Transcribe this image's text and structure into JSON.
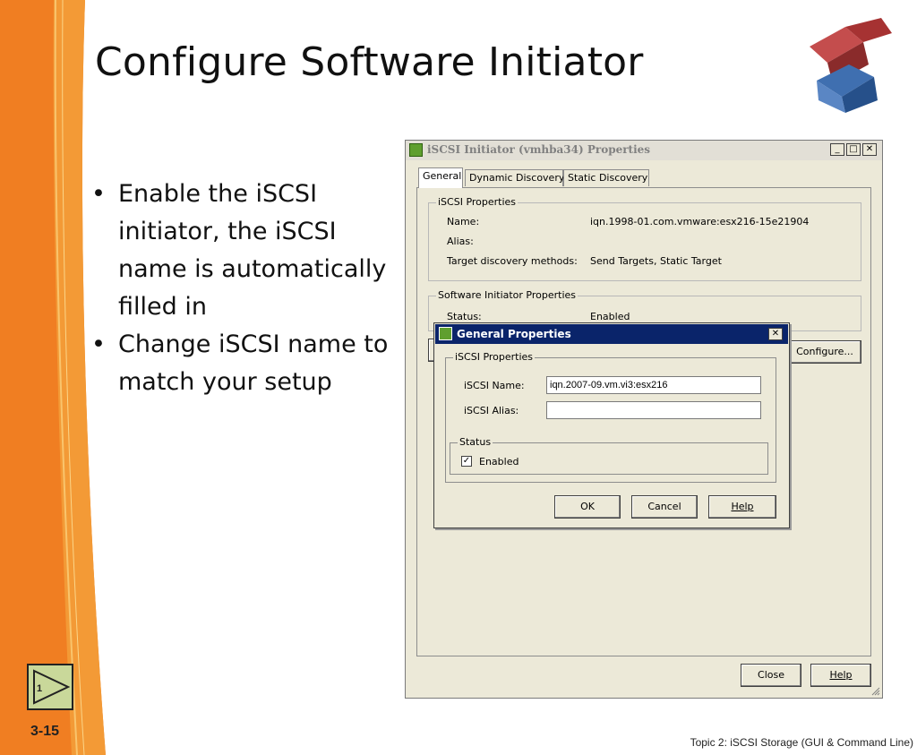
{
  "slide": {
    "title": "Configure Software Initiator",
    "bullets": [
      "Enable the iSCSI initiator, the iSCSI name is automatically filled in",
      "Change iSCSI name to match your setup"
    ],
    "nav_button_label": "1",
    "slide_number": "3-15",
    "footer": "Topic 2:  iSCSI Storage (GUI & Command Line)",
    "colors": {
      "band": "#f07e22",
      "band_light": "#f7b64a",
      "logo_red": "#b33a3a",
      "logo_blue": "#2f5f9f"
    }
  },
  "main_dialog": {
    "title": "iSCSI Initiator (vmhba34) Properties",
    "window_buttons": {
      "minimize": "_",
      "maximize": "□",
      "close": "✕"
    },
    "tabs": [
      "General",
      "Dynamic Discovery",
      "Static Discovery"
    ],
    "iscsi_props": {
      "legend": "iSCSI Properties",
      "name_label": "Name:",
      "name_value": "iqn.1998-01.com.vmware:esx216-15e21904",
      "alias_label": "Alias:",
      "alias_value": "",
      "methods_label": "Target discovery methods:",
      "methods_value": "Send Targets, Static Target"
    },
    "software_props": {
      "legend": "Software Initiator Properties",
      "status_label": "Status:",
      "status_value": "Enabled"
    },
    "configure_button": "Configure...",
    "close_button": "Close",
    "help_button": "Help"
  },
  "general_dialog": {
    "title": "General Properties",
    "close_glyph": "✕",
    "iscsi_legend": "iSCSI Properties",
    "name_label": "iSCSI Name:",
    "name_value": "iqn.2007-09.vm.vi3:esx216",
    "alias_label": "iSCSI Alias:",
    "alias_value": "",
    "status_legend": "Status",
    "enabled_label": "Enabled",
    "enabled_checked": true,
    "check_glyph": "✓",
    "ok": "OK",
    "cancel": "Cancel",
    "help": "Help"
  }
}
